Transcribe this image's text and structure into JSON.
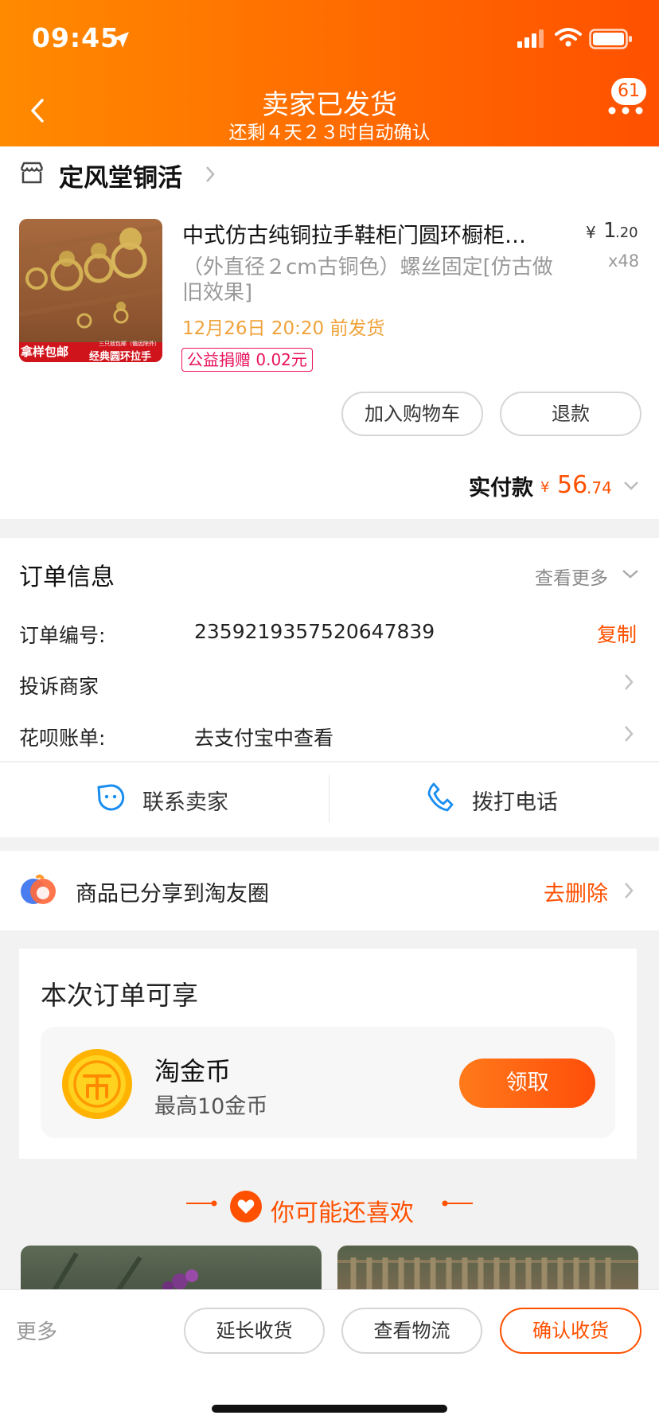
{
  "status_bar": {
    "time": "09:45"
  },
  "nav": {
    "title": "卖家已发货",
    "subtitle": "还剩４天２３时自动确认",
    "cart_badge": "61"
  },
  "shop": {
    "name": "定风堂铜活"
  },
  "product": {
    "image_caption_left": "拿样包邮",
    "image_caption_right": "经典圆环拉手",
    "image_caption_top": "三只就包邮（偏远除外）",
    "title": "中式仿古纯铜拉手鞋柜门圆环橱柜…",
    "spec": "（外直径２cm古铜色）螺丝固定[仿古做旧效果]",
    "ship_time": "12月26日 20:20 前发货",
    "charity_tag": "公益捐赠 0.02元",
    "price_currency": "¥",
    "price_int": "1",
    "price_dec": ".20",
    "quantity": "x48"
  },
  "actions": {
    "add_to_cart": "加入购物车",
    "refund": "退款"
  },
  "payment": {
    "label": "实付款",
    "currency": "¥",
    "amount_int": "56",
    "amount_dec": ".74"
  },
  "order_info": {
    "title": "订单信息",
    "more": "查看更多",
    "order_no_label": "订单编号:",
    "order_no": "2359219357520647839",
    "copy": "复制",
    "complaint": "投诉商家",
    "huabei_label": "花呗账单:",
    "huabei_value": "去支付宝中查看"
  },
  "contact": {
    "seller": "联系卖家",
    "call": "拨打电话"
  },
  "share": {
    "text": "商品已分享到淘友圈",
    "delete": "去删除"
  },
  "benefits": {
    "title": "本次订单可享",
    "coin_name": "淘金币",
    "coin_desc": "最高10金币",
    "claim": "领取"
  },
  "recommend": {
    "title": "你可能还喜欢"
  },
  "bottom_bar": {
    "more": "更多",
    "extend": "延长收货",
    "logistics": "查看物流",
    "confirm": "确认收货"
  },
  "colors": {
    "accent": "#ff5000",
    "header_start": "#ff8a00",
    "header_end": "#ff5000",
    "ship_time": "#f0a23a"
  }
}
